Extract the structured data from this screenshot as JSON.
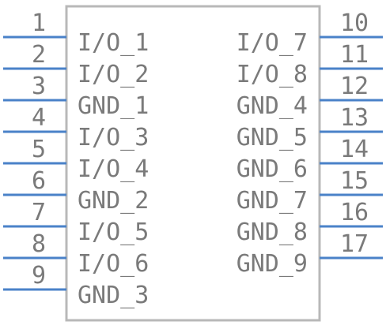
{
  "component": {
    "left_pins": [
      {
        "number": "1",
        "name": "I/O_1"
      },
      {
        "number": "2",
        "name": "I/O_2"
      },
      {
        "number": "3",
        "name": "GND_1"
      },
      {
        "number": "4",
        "name": "I/O_3"
      },
      {
        "number": "5",
        "name": "I/O_4"
      },
      {
        "number": "6",
        "name": "GND_2"
      },
      {
        "number": "7",
        "name": "I/O_5"
      },
      {
        "number": "8",
        "name": "I/O_6"
      },
      {
        "number": "9",
        "name": "GND_3"
      }
    ],
    "right_pins": [
      {
        "number": "10",
        "name": "I/O_7"
      },
      {
        "number": "11",
        "name": "I/O_8"
      },
      {
        "number": "12",
        "name": "GND_4"
      },
      {
        "number": "13",
        "name": "GND_5"
      },
      {
        "number": "14",
        "name": "GND_6"
      },
      {
        "number": "15",
        "name": "GND_7"
      },
      {
        "number": "16",
        "name": "GND_8"
      },
      {
        "number": "17",
        "name": "GND_9"
      }
    ]
  },
  "colors": {
    "pin_line": "#4a82c8",
    "body_outline": "#b8b8b8",
    "text": "#7a7a7a"
  }
}
